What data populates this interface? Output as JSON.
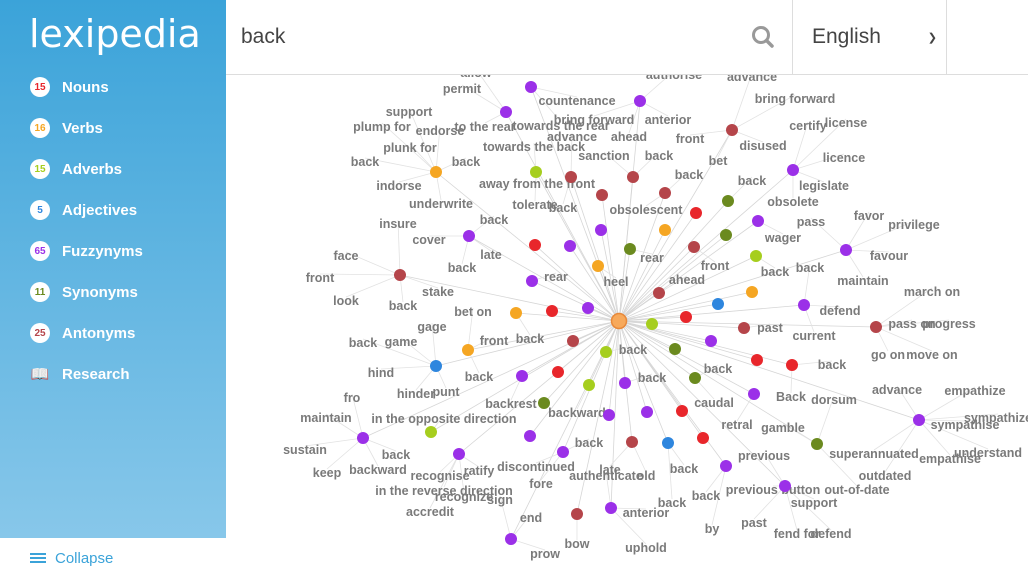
{
  "app": {
    "logo": "lexipedia"
  },
  "sidebar": {
    "items": [
      {
        "count": "15",
        "label": "Nouns",
        "color": "#e8262b"
      },
      {
        "count": "16",
        "label": "Verbs",
        "color": "#f5a623"
      },
      {
        "count": "15",
        "label": "Adverbs",
        "color": "#a6ce1e"
      },
      {
        "count": "5",
        "label": "Adjectives",
        "color": "#2e86de"
      },
      {
        "count": "65",
        "label": "Fuzzynyms",
        "color": "#9b30e8"
      },
      {
        "count": "11",
        "label": "Synonyms",
        "color": "#6b8a1f"
      },
      {
        "count": "25",
        "label": "Antonyms",
        "color": "#b5454a"
      }
    ],
    "research": {
      "label": "Research",
      "icon": "book-icon"
    },
    "collapse": {
      "label": "Collapse",
      "icon": "menu-icon"
    }
  },
  "header": {
    "search_value": "back",
    "search_icon": "search-icon",
    "language": "English"
  },
  "graph": {
    "center": "back",
    "colors": {
      "noun": "#e8262b",
      "verb": "#f5a623",
      "adverb": "#a6ce1e",
      "adjective": "#2e86de",
      "fuzzynym": "#9b30e8",
      "synonym": "#6b8a1f",
      "antonym": "#b5454a",
      "center": "#f7a95b"
    },
    "labels": [
      "allow",
      "authorise",
      "advance",
      "permit",
      "countenance",
      "bring forward",
      "support",
      "bring forward",
      "anterior",
      "plump for",
      "endorse",
      "to the rear",
      "towards the rear",
      "certify",
      "license",
      "advance",
      "ahead",
      "front",
      "plunk for",
      "towards the back",
      "disused",
      "sanction",
      "back",
      "bet",
      "licence",
      "back",
      "back",
      "back",
      "away from the front",
      "back",
      "indorse",
      "legislate",
      "underwrite",
      "tolerate",
      "back",
      "obsolescent",
      "obsolete",
      "back",
      "favor",
      "insure",
      "pass",
      "privilege",
      "cover",
      "wager",
      "late",
      "rear",
      "face",
      "favour",
      "front",
      "back",
      "back",
      "back",
      "front",
      "rear",
      "heel",
      "ahead",
      "maintain",
      "look",
      "stake",
      "march on",
      "back",
      "bet on",
      "defend",
      "gage",
      "past",
      "pass on",
      "progress",
      "current",
      "front",
      "back",
      "back",
      "game",
      "back",
      "go on",
      "move on",
      "hind",
      "back",
      "back",
      "back",
      "back",
      "hinder",
      "punt",
      "advance",
      "empathize",
      "fro",
      "backrest",
      "Back",
      "dorsum",
      "caudal",
      "backward",
      "maintain",
      "in the opposite direction",
      "retral",
      "gamble",
      "sympathize",
      "sympathise",
      "sustain",
      "back",
      "back",
      "previous",
      "superannuated",
      "understand",
      "empathise",
      "discontinued",
      "backward",
      "late",
      "keep",
      "recognise",
      "ratify",
      "authenticate",
      "old",
      "back",
      "outdated",
      "in the reverse direction",
      "fore",
      "previous button",
      "out-of-date",
      "recognize",
      "sign",
      "back",
      "back",
      "support",
      "accredit",
      "anterior",
      "end",
      "past",
      "by",
      "fend for",
      "defend",
      "bow",
      "uphold",
      "prow"
    ],
    "dots": [
      "fuzzynym",
      "fuzzynym",
      "fuzzynym",
      "antonym",
      "adverb",
      "antonym",
      "antonym",
      "antonym",
      "antonym",
      "fuzzynym",
      "verb",
      "synonym",
      "noun",
      "fuzzynym",
      "fuzzynym",
      "verb",
      "synonym",
      "antonym",
      "fuzzynym",
      "noun",
      "fuzzynym",
      "synonym",
      "adverb",
      "fuzzynym",
      "verb",
      "fuzzynym",
      "antonym",
      "antonym",
      "verb",
      "adjective",
      "fuzzynym",
      "verb",
      "noun",
      "fuzzynym",
      "adverb",
      "noun",
      "antonym",
      "antonym",
      "verb",
      "antonym",
      "fuzzynym",
      "synonym",
      "adverb",
      "noun",
      "noun",
      "adjective",
      "fuzzynym",
      "noun",
      "fuzzynym",
      "synonym",
      "adverb",
      "fuzzynym",
      "synonym",
      "fuzzynym",
      "fuzzynym",
      "noun",
      "fuzzynym",
      "fuzzynym",
      "adverb",
      "fuzzynym",
      "antonym",
      "adjective",
      "noun",
      "synonym",
      "fuzzynym",
      "fuzzynym",
      "fuzzynym",
      "fuzzynym",
      "antonym",
      "fuzzynym",
      "fuzzynym"
    ]
  }
}
